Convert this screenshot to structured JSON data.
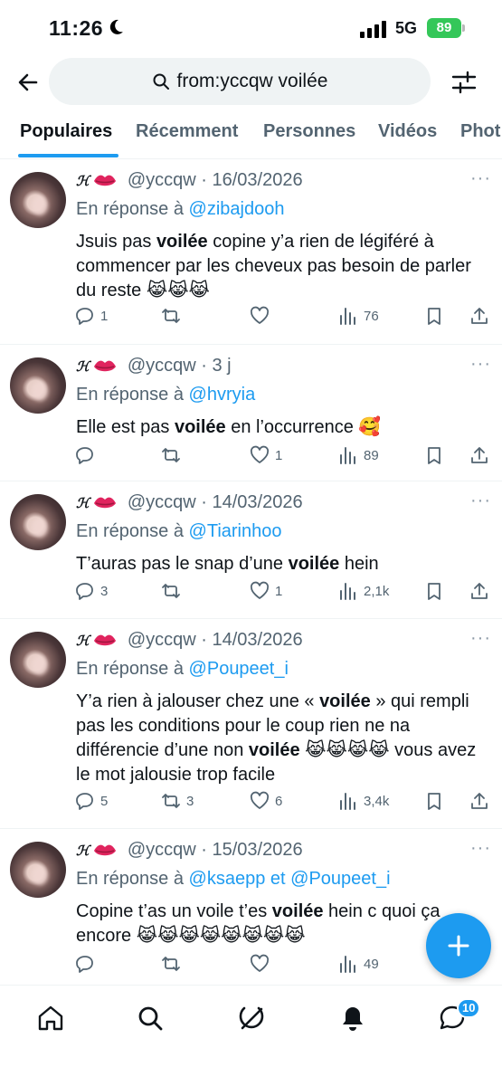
{
  "status_bar": {
    "time": "11:26",
    "network": "5G",
    "battery": "89"
  },
  "search": {
    "query": "from:yccqw voilée"
  },
  "tabs": [
    {
      "label": "Populaires",
      "active": true
    },
    {
      "label": "Récemment",
      "active": false
    },
    {
      "label": "Personnes",
      "active": false
    },
    {
      "label": "Vidéos",
      "active": false
    },
    {
      "label": "Phot",
      "active": false
    }
  ],
  "colors": {
    "accent": "#1d9bf0",
    "secondary_text": "#536471",
    "battery": "#34c759"
  },
  "tweets": [
    {
      "name": "ℋ",
      "handle": "@yccqw",
      "date": "· 16/03/2026",
      "reply_prefix": "En réponse à",
      "reply_to": "@zibajdooh",
      "text_parts": [
        "Jsuis pas ",
        "voilée",
        " copine y’a rien de légiféré à commencer par les cheveux pas besoin de parler du reste 😹😹😹"
      ],
      "replies": "1",
      "retweets": "",
      "likes": "",
      "views": "76"
    },
    {
      "name": "ℋ",
      "handle": "@yccqw",
      "date": "· 3 j",
      "reply_prefix": "En réponse à",
      "reply_to": "@hvryia",
      "text_parts": [
        "Elle est pas ",
        "voilée",
        " en l’occurrence 🥰"
      ],
      "replies": "",
      "retweets": "",
      "likes": "1",
      "views": "89"
    },
    {
      "name": "ℋ",
      "handle": "@yccqw",
      "date": "· 14/03/2026",
      "reply_prefix": "En réponse à",
      "reply_to": "@Tiarinhoo",
      "text_parts": [
        "T’auras pas le snap d’une ",
        "voilée",
        " hein"
      ],
      "replies": "3",
      "retweets": "",
      "likes": "1",
      "views": "2,1k"
    },
    {
      "name": "ℋ",
      "handle": "@yccqw",
      "date": "· 14/03/2026",
      "reply_prefix": "En réponse à",
      "reply_to": "@Poupeet_i",
      "text_parts": [
        "Y’a rien à jalouser chez une « ",
        "voilée",
        " » qui rempli pas les conditions pour le coup rien ne na différencie d’une non ",
        "voilée",
        " 😹😹😹😹 vous avez le mot jalousie trop facile"
      ],
      "replies": "5",
      "retweets": "3",
      "likes": "6",
      "views": "3,4k"
    },
    {
      "name": "ℋ",
      "handle": "@yccqw",
      "date": "· 15/03/2026",
      "reply_prefix": "En réponse à",
      "reply_to": "@ksaepp et @Poupeet_i",
      "text_parts": [
        "Copine t’as un voile t’es ",
        "voilée",
        " hein c quoi ça encore 😹😹😹😹😹😹😹😹"
      ],
      "replies": "",
      "retweets": "",
      "likes": "",
      "views": "49"
    }
  ],
  "nav": {
    "messages_badge": "10"
  },
  "icons": [
    "back-arrow-icon",
    "search-icon",
    "filter-icon",
    "more-icon",
    "reply-icon",
    "retweet-icon",
    "like-icon",
    "views-icon",
    "bookmark-icon",
    "share-icon",
    "plus-icon",
    "home-icon",
    "grok-icon",
    "bell-icon",
    "messages-icon"
  ]
}
